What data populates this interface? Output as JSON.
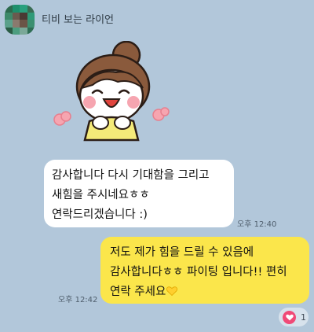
{
  "chat": {
    "sender_name": "티비 보는 라이언",
    "messages": [
      {
        "direction": "incoming",
        "lines": [
          "감사합니다 다시 기대함을 그리고",
          "새힘을 주시네요ㅎㅎ",
          "연락드리겠습니다 :)"
        ],
        "time": "오후 12:40"
      },
      {
        "direction": "outgoing",
        "lines": [
          "저도 제가 힘을 드릴 수 있음에",
          "감사합니다ㅎㅎ 파이팅 입니다!! 편히",
          "연락 주세요"
        ],
        "time": "오후 12:42",
        "trailing_icon": "yellow-heart-icon"
      }
    ],
    "reaction": {
      "icon": "heart-icon",
      "count": "1",
      "color": "#f04a77"
    }
  },
  "colors": {
    "background": "#b2c7da",
    "incoming_bubble": "#ffffff",
    "outgoing_bubble": "#fbe64b"
  }
}
